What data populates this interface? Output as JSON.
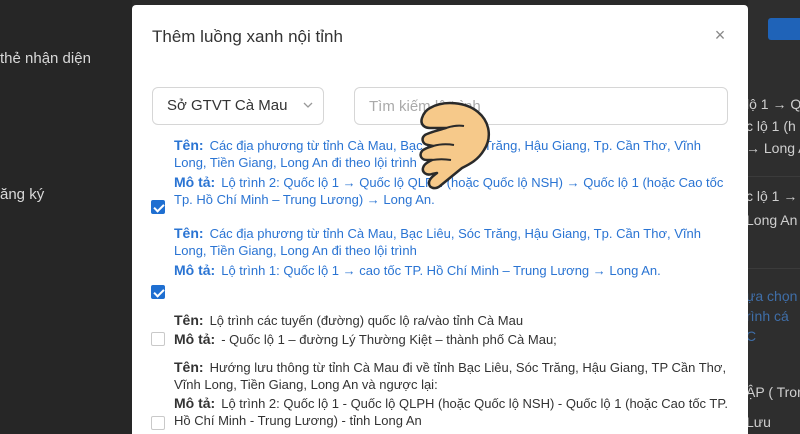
{
  "background": {
    "left_items": [
      {
        "label": "thẻ nhận diện"
      },
      {
        "label": "ăng ký"
      }
    ],
    "right_items": [
      {
        "label": "lộ 1 → Q"
      },
      {
        "label": "c lộ 1 (h"
      },
      {
        "label": "→ Long A"
      },
      {
        "label": "c lộ 1 → C"
      },
      {
        "label": "Long An"
      },
      {
        "label": "ựa chọn"
      },
      {
        "label": "rình cá"
      },
      {
        "label": "C"
      },
      {
        "label": "ẬP ( Tron"
      },
      {
        "label": "Lưu"
      }
    ]
  },
  "modal": {
    "title": "Thêm luồng xanh nội tỉnh",
    "close_label": "×",
    "select_value": "Sở GTVT Cà Mau",
    "search_placeholder": "Tìm kiếm lộ trình",
    "routes": [
      {
        "checked": true,
        "style": "blue",
        "ten_label": "Tên:",
        "ten": "Các địa phương từ tỉnh Cà Mau, Bạc Liêu, Sóc Trăng, Hậu Giang, Tp. Cần Thơ,  Vĩnh Long, Tiền Giang, Long An đi theo lội trình",
        "mota_label": "Mô tả:",
        "mota": "Lộ trình 2: Quốc lộ 1 → Quốc lộ QLPH (hoặc Quốc lộ NSH) → Quốc lộ 1 (hoặc Cao tốc Tp. Hồ Chí Minh – Trung Lương) → Long An."
      },
      {
        "checked": true,
        "style": "blue",
        "ten_label": "Tên:",
        "ten": "Các địa phương từ tỉnh Cà Mau, Bạc Liêu, Sóc Trăng, Hậu Giang, Tp. Cần Thơ,  Vĩnh Long, Tiền Giang, Long An đi theo lội trình",
        "mota_label": "Mô tả:",
        "mota": "Lộ trình 1: Quốc lộ 1 → cao tốc TP. Hồ Chí Minh – Trung Lương → Long An."
      },
      {
        "checked": false,
        "style": "dark",
        "ten_label": "Tên:",
        "ten": "Lộ trình các tuyến (đường) quốc lộ ra/vào tỉnh Cà Mau",
        "mota_label": "Mô tả:",
        "mota": "- Quốc lộ 1 – đường Lý Thường Kiệt – thành phố Cà Mau;"
      },
      {
        "checked": false,
        "style": "dark",
        "ten_label": "Tên:",
        "ten": "Hướng lưu thông từ tỉnh Cà Mau đi về tỉnh Bạc Liêu, Sóc Trăng, Hậu Giang, TP Cần Thơ, Vĩnh Long, Tiền Giang, Long An và ngược lại:",
        "mota_label": "Mô tả:",
        "mota": "Lộ trình 2: Quốc lộ 1 - Quốc lộ QLPH (hoặc Quốc lộ NSH) - Quốc lộ 1 (hoặc Cao tốc TP. Hồ Chí Minh - Trung Lương) - tỉnh Long An"
      }
    ]
  },
  "colors": {
    "accent": "#1f6fd1",
    "link_blue": "#2a74d3",
    "text_dark": "#333333"
  }
}
